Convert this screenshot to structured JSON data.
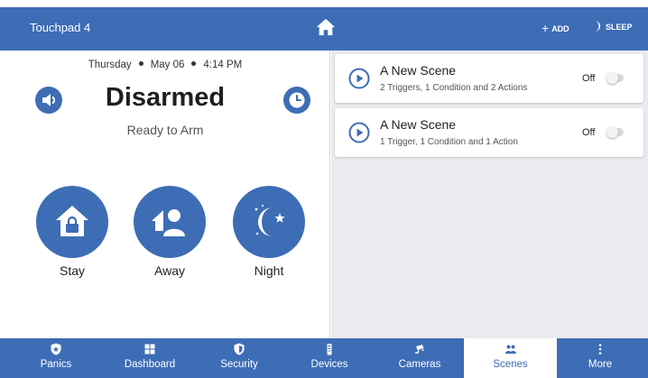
{
  "colors": {
    "primary": "#3d6db5",
    "panel_bg": "#e9ebee",
    "text": "#222222"
  },
  "topbar": {
    "title": "Touchpad 4",
    "home_icon": "home-icon",
    "add_label": "ADD",
    "add_icon": "plus",
    "sleep_label": "SLEEP",
    "sleep_icon": "moon-icon"
  },
  "left": {
    "day": "Thursday",
    "date": "May 06",
    "time": "4:14 PM",
    "status": "Disarmed",
    "substatus": "Ready to Arm",
    "speaker_icon": "speaker-icon",
    "clock_icon": "clock-icon",
    "arm_buttons": [
      {
        "label": "Stay",
        "icon": "home-lock-icon"
      },
      {
        "label": "Away",
        "icon": "people-icon"
      },
      {
        "label": "Night",
        "icon": "moon-stars-icon"
      }
    ]
  },
  "scenes": [
    {
      "name": "A New Scene",
      "description": "2 Triggers, 1 Condition and 2 Actions",
      "state": "Off",
      "enabled": false
    },
    {
      "name": "A New Scene",
      "description": "1 Trigger, 1 Condition and 1 Action",
      "state": "Off",
      "enabled": false
    }
  ],
  "bottomnav": {
    "active": "Scenes",
    "items": [
      {
        "label": "Panics",
        "icon": "shield-star-icon"
      },
      {
        "label": "Dashboard",
        "icon": "grid-icon"
      },
      {
        "label": "Security",
        "icon": "shield-icon"
      },
      {
        "label": "Devices",
        "icon": "remote-icon"
      },
      {
        "label": "Cameras",
        "icon": "camera-icon"
      },
      {
        "label": "Scenes",
        "icon": "scenes-icon"
      },
      {
        "label": "More",
        "icon": "more-vertical-icon"
      }
    ]
  }
}
